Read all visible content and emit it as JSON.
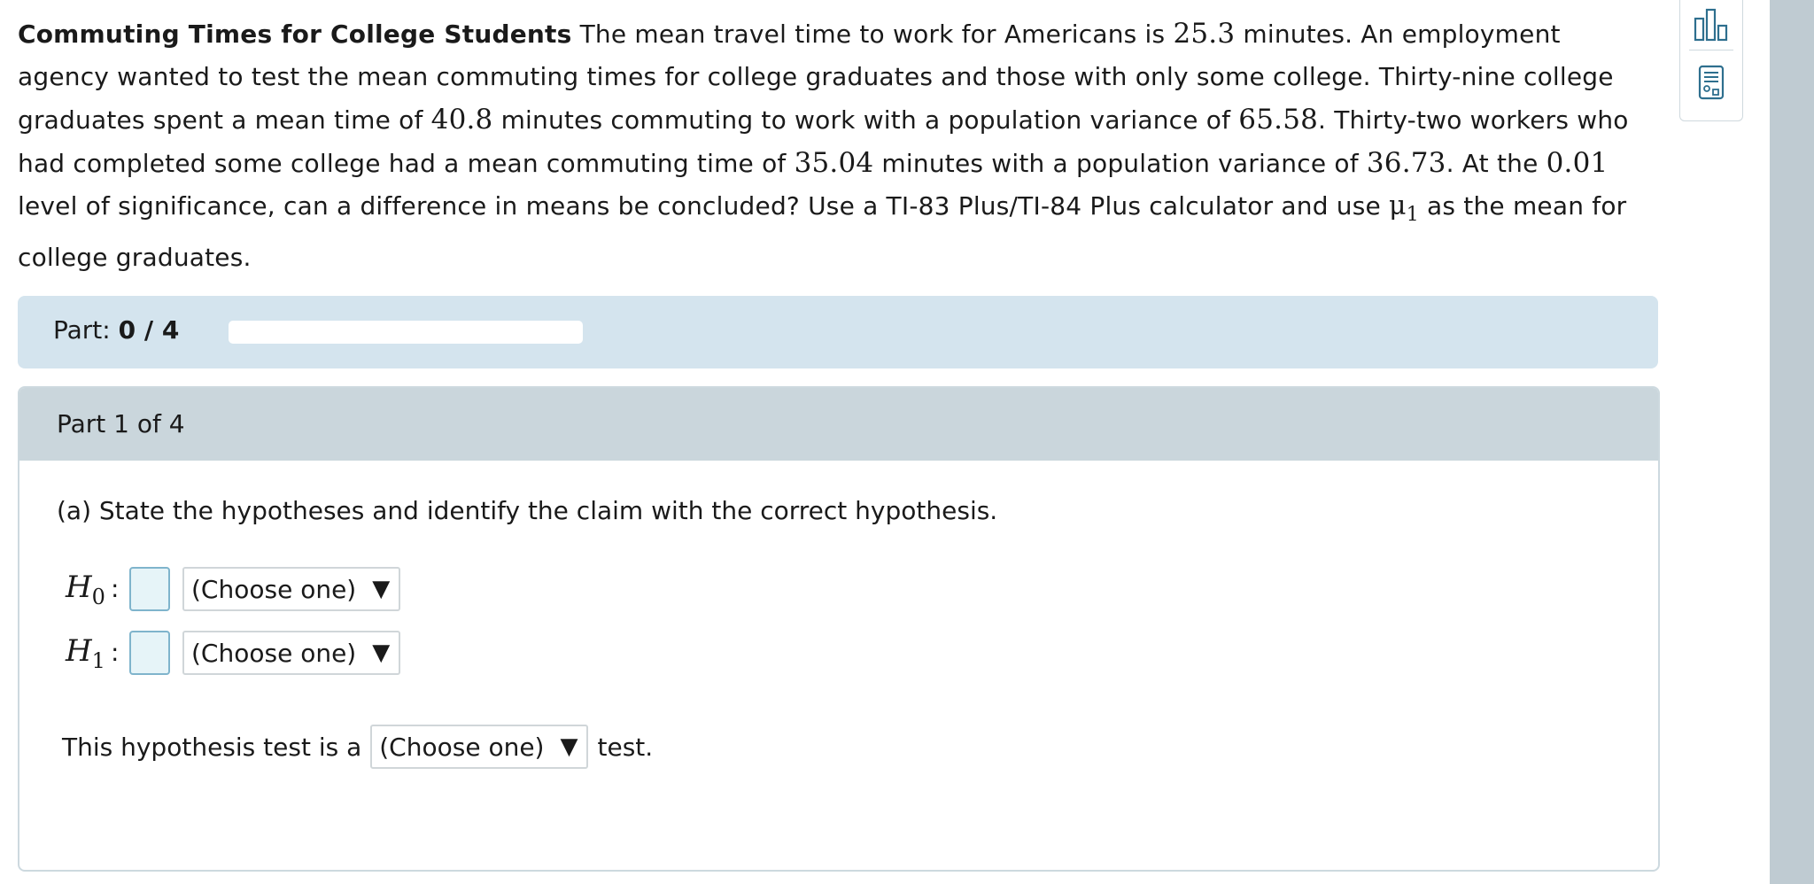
{
  "problem": {
    "title": "Commuting Times for College Students",
    "s1": " The mean travel time to work for Americans is ",
    "v_mean_all": "25.3",
    "s2": " minutes. An employment agency wanted to test the mean commuting times for college graduates and those with only some college. Thirty-nine college graduates spent a mean time of ",
    "v_mean_grad": "40.8",
    "s3": " minutes commuting to work with a population variance of ",
    "v_var_grad": "65.58",
    "s4": ". Thirty-two workers who had completed some college had a mean commuting time of ",
    "v_mean_some": "35.04",
    "s5": " minutes with a population variance of ",
    "v_var_some": "36.73",
    "s6": ". At the ",
    "v_alpha": "0.01",
    "s7": " level of significance, can a difference in means be concluded? Use a TI-83 Plus/TI-84 Plus calculator and use ",
    "mu_symbol": "μ",
    "mu_sub": "1",
    "s8": " as the mean for college graduates."
  },
  "part_bar": {
    "label": "Part:",
    "progress_text": "0 / 4",
    "progress_fraction": 0
  },
  "part": {
    "header": "Part 1 of 4",
    "question": "(a) State the hypotheses and identify the claim with the correct hypothesis.",
    "h0": {
      "symbol": "H",
      "sub": "0",
      "colon": ":",
      "select": "(Choose one)"
    },
    "h1": {
      "symbol": "H",
      "sub": "1",
      "colon": ":",
      "select": "(Choose one)"
    },
    "test_prefix": "This hypothesis test is a",
    "test_select": "(Choose one)",
    "test_suffix": "test.",
    "arrow": "▼"
  },
  "tools": [
    "bar-chart-icon",
    "calculator-icon"
  ],
  "colors": {
    "part_bar_bg": "#d4e4ee",
    "part_header_bg": "#cad6dc",
    "answer_box_bg": "#e6f4f8",
    "answer_box_border": "#7fb4cc",
    "scrollbar": "#bfcbd2",
    "tool_icon": "#2e6f8e"
  }
}
